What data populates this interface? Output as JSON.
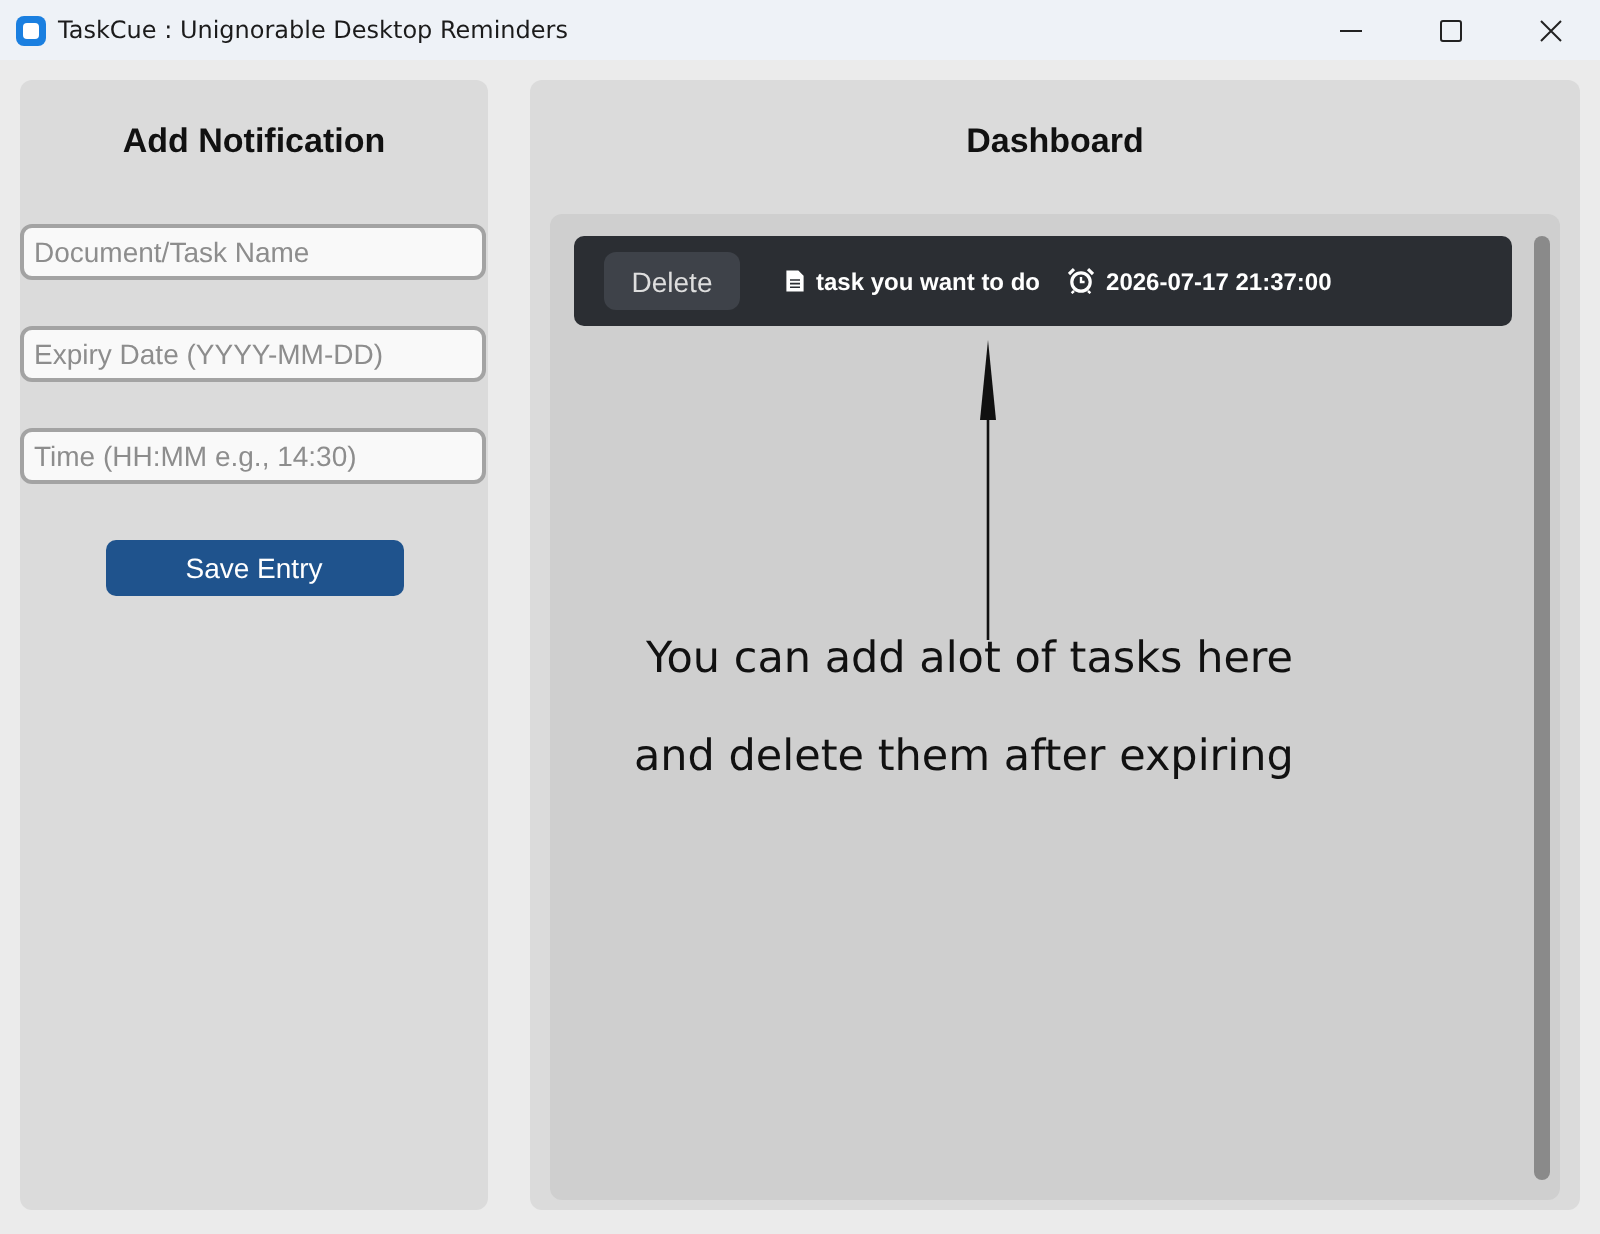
{
  "window": {
    "title": "TaskCue : Unignorable Desktop Reminders"
  },
  "add_panel": {
    "title": "Add Notification",
    "fields": [
      {
        "placeholder": "Document/Task Name"
      },
      {
        "placeholder": "Expiry Date (YYYY-MM-DD)"
      },
      {
        "placeholder": "Time (HH:MM e.g., 14:30)"
      }
    ],
    "save_button": "Save Entry"
  },
  "dashboard": {
    "title": "Dashboard",
    "tasks": [
      {
        "delete_button": "Delete",
        "name": "task you want to do",
        "due": "2026-07-17 21:37:00"
      }
    ]
  },
  "annotation": {
    "lines": [
      "You can add alot of tasks here",
      "and delete them after expiring"
    ]
  }
}
